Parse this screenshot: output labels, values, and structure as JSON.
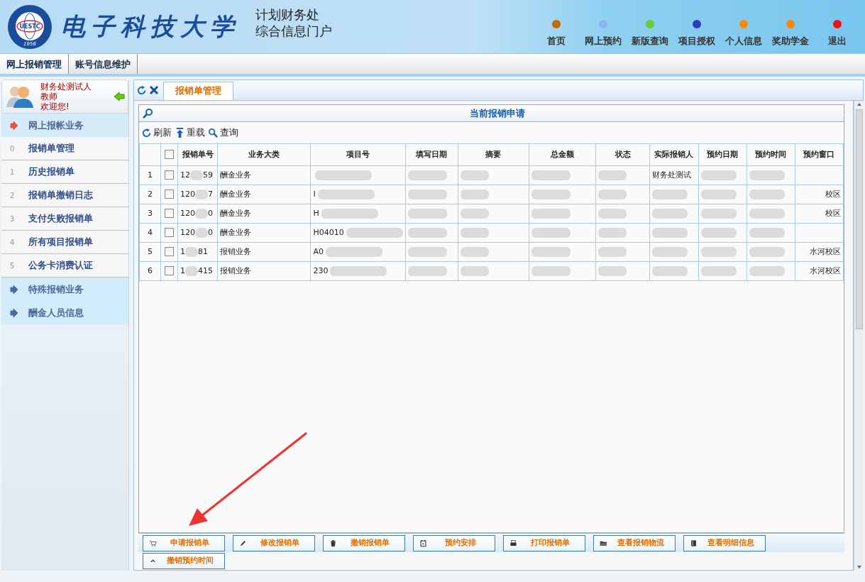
{
  "header": {
    "logo_year": "1956",
    "logo_initials": "UESTC",
    "school_name": "电子科技大学",
    "subtitle_lines": [
      "计划财务处",
      "综合信息门户"
    ],
    "nav": [
      {
        "label": "首页",
        "color": "#c06a00"
      },
      {
        "label": "网上预约",
        "color": "#8fb4ee"
      },
      {
        "label": "新版查询",
        "color": "#66cc33"
      },
      {
        "label": "项目授权",
        "color": "#2a3fbf"
      },
      {
        "label": "个人信息",
        "color": "#ff8800"
      },
      {
        "label": "奖助学金",
        "color": "#ff8800"
      },
      {
        "label": "退出",
        "color": "#ee1111"
      }
    ]
  },
  "menu_bar": [
    {
      "label": "网上报销管理",
      "selected": true
    },
    {
      "label": "账号信息维护",
      "selected": false
    }
  ],
  "sidebar": {
    "user_lines": [
      "财务处测试人",
      "教师",
      "欢迎您!"
    ],
    "items": [
      {
        "kind": "section",
        "label": "网上报帐业务",
        "selected": true
      },
      {
        "kind": "item",
        "index": "0",
        "label": "报销单管理"
      },
      {
        "kind": "item",
        "index": "1",
        "label": "历史报销单"
      },
      {
        "kind": "item",
        "index": "2",
        "label": "报销单撤销日志"
      },
      {
        "kind": "item",
        "index": "3",
        "label": "支付失败报销单"
      },
      {
        "kind": "item",
        "index": "4",
        "label": "所有项目报销单"
      },
      {
        "kind": "item",
        "index": "5",
        "label": "公务卡消费认证"
      },
      {
        "kind": "section",
        "label": "特殊报销业务",
        "selected": false
      },
      {
        "kind": "section",
        "label": "酬金人员信息",
        "selected": false
      }
    ]
  },
  "tab": {
    "label": "报销单管理"
  },
  "panel": {
    "title": "当前报销申请",
    "toolbar": [
      {
        "label": "刷新"
      },
      {
        "label": "重载"
      },
      {
        "label": "查询"
      }
    ],
    "select_all_checked": false,
    "columns": [
      "报销单号",
      "业务大类",
      "项目号",
      "填写日期",
      "摘要",
      "总金额",
      "状态",
      "实际报销人",
      "预约日期",
      "预约时间",
      "预约窗口"
    ],
    "rows": [
      {
        "row_no": "1",
        "checked": false,
        "bill_start": "12",
        "bill_end": "59",
        "category": "酬金业务",
        "project": "",
        "reporter": "财务处测试",
        "window": ""
      },
      {
        "row_no": "2",
        "checked": false,
        "bill_start": "120",
        "bill_end": "7",
        "category": "酬金业务",
        "project": "I",
        "reporter": "",
        "window": "校区"
      },
      {
        "row_no": "3",
        "checked": false,
        "bill_start": "120",
        "bill_end": "0",
        "category": "酬金业务",
        "project": "H",
        "reporter": "",
        "window": "校区"
      },
      {
        "row_no": "4",
        "checked": false,
        "bill_start": "120",
        "bill_end": "0",
        "category": "酬金业务",
        "project": "H04010",
        "reporter": "",
        "window": ""
      },
      {
        "row_no": "5",
        "checked": false,
        "bill_start": "1",
        "bill_end": "81",
        "category": "报销业务",
        "project": "A0",
        "reporter": "",
        "window": "水河校区"
      },
      {
        "row_no": "6",
        "checked": false,
        "bill_start": "1",
        "bill_end": "415",
        "category": "报销业务",
        "project": "230",
        "reporter": "",
        "window": "水河校区"
      }
    ],
    "buttons": [
      {
        "label": "申请报销单"
      },
      {
        "label": "修改报销单"
      },
      {
        "label": "撤销报销单"
      },
      {
        "label": "预约安排"
      },
      {
        "label": "打印报销单"
      },
      {
        "label": "查看报销物流"
      },
      {
        "label": "查看明细信息"
      },
      {
        "label": "撤销预约时间"
      }
    ]
  }
}
